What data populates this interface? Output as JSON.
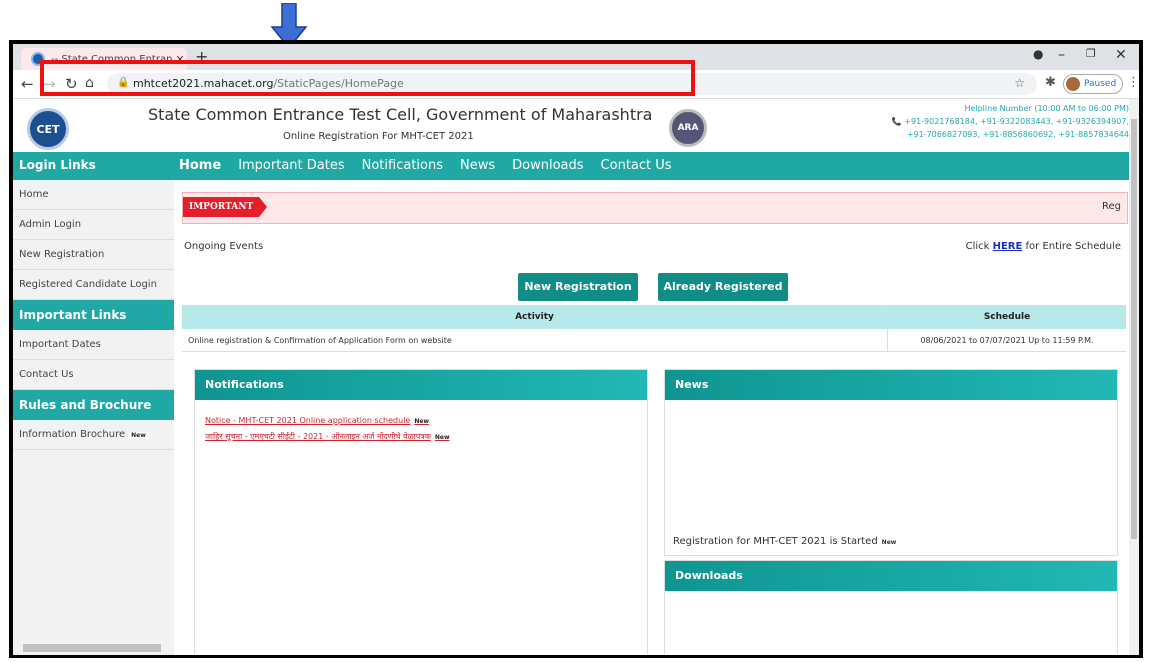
{
  "browser": {
    "tab_title": "-- State Common Entrance Test (",
    "tab_close": "✕",
    "new_tab": "+",
    "url_host": "mhtcet2021.mahacet.org",
    "url_path": "/StaticPages/HomePage",
    "profile_status": "Paused"
  },
  "header": {
    "title": "State Common Entrance Test Cell, Government of Maharashtra",
    "subtitle": "Online Registration For MHT-CET 2021",
    "logo_text": "CET",
    "logo2_text": "ARA",
    "helpline_title": "Helpline Number (10:00 AM to 06:00 PM)",
    "helpline_line1": "+91-9021768184, +91-9322083443, +91-9326394907,",
    "helpline_line2": "+91-7066827093, +91-8856860692, +91-8857834644"
  },
  "nav": {
    "login_title": "Login Links",
    "items": [
      "Home",
      "Important Dates",
      "Notifications",
      "News",
      "Downloads",
      "Contact Us"
    ]
  },
  "sidebar": {
    "login_links": [
      "Home",
      "Admin Login",
      "New Registration",
      "Registered Candidate Login"
    ],
    "important_title": "Important Links",
    "important_links": [
      "Important Dates",
      "Contact Us"
    ],
    "rules_title": "Rules and Brochure",
    "brochure": "Information Brochure",
    "new_badge": "New"
  },
  "main": {
    "important_tag": "IMPORTANT",
    "marquee_text": "Reg",
    "ongoing": "Ongoing Events",
    "schedule_prefix": "Click",
    "schedule_link": "HERE",
    "schedule_suffix": "for Entire Schedule",
    "btn_new": "New Registration",
    "btn_already": "Already Registered",
    "table": {
      "headers": [
        "Activity",
        "Schedule"
      ],
      "row": [
        "Online registration & Confirmation of Application Form on website",
        "08/06/2021 to 07/07/2021 Up to 11:59 P.M."
      ]
    }
  },
  "panels": {
    "notifications_title": "Notifications",
    "notice1": "Notice - MHT-CET 2021 Online application schedule",
    "notice2": "जाहिर सूचना - एमएचटी सीईटी - 2021 - ऑनलाइन अर्ज नोंदणीचे वेळापत्रक",
    "news_title": "News",
    "news_item": "Registration for MHT-CET 2021 is Started",
    "downloads_title": "Downloads",
    "new_badge": "New"
  },
  "colors": {
    "accent": "#1fa8a4",
    "important_red": "#e41e2b",
    "annotation_red": "#ee1111",
    "annotation_arrow": "#3b6fd4"
  }
}
